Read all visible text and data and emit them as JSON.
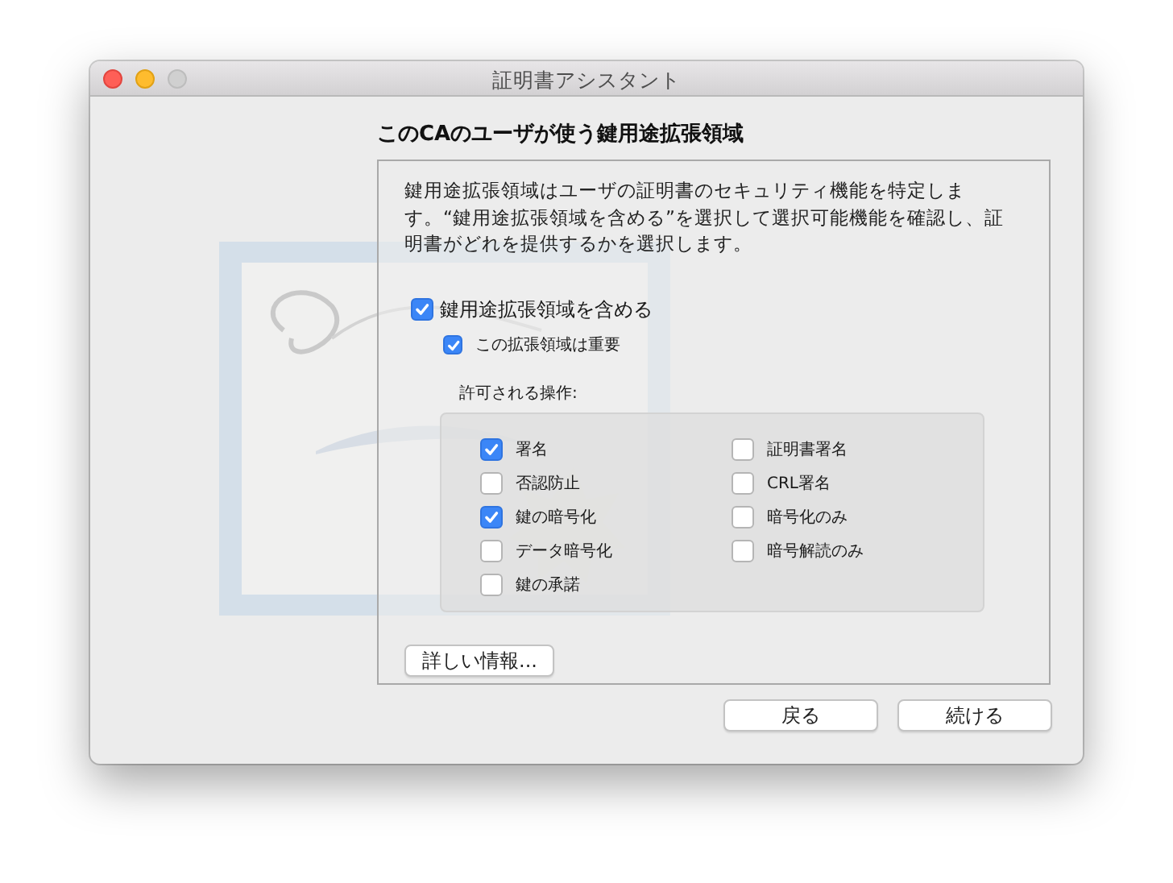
{
  "window": {
    "title": "証明書アシスタント"
  },
  "heading": "このCAのユーザが使う鍵用途拡張領域",
  "description": "鍵用途拡張領域はユーザの証明書のセキュリティ機能を特定します。“鍵用途拡張領域を含める”を選択して選択可能機能を確認し、証明書がどれを提供するかを選択します。",
  "include_extension": {
    "label": "鍵用途拡張領域を含める",
    "checked": true
  },
  "critical": {
    "label": "この拡張領域は重要",
    "checked": true
  },
  "operations_label": "許可される操作:",
  "operation_columns": [
    {
      "items": [
        {
          "label": "署名",
          "checked": true
        },
        {
          "label": "否認防止",
          "checked": false
        },
        {
          "label": "鍵の暗号化",
          "checked": true
        },
        {
          "label": "データ暗号化",
          "checked": false
        },
        {
          "label": "鍵の承諾",
          "checked": false
        }
      ]
    },
    {
      "items": [
        {
          "label": "証明書署名",
          "checked": false
        },
        {
          "label": "CRL署名",
          "checked": false
        },
        {
          "label": "暗号化のみ",
          "checked": false
        },
        {
          "label": "暗号解読のみ",
          "checked": false
        }
      ]
    }
  ],
  "more_info_button": "詳しい情報...",
  "buttons": [
    "戻る",
    "続ける"
  ]
}
